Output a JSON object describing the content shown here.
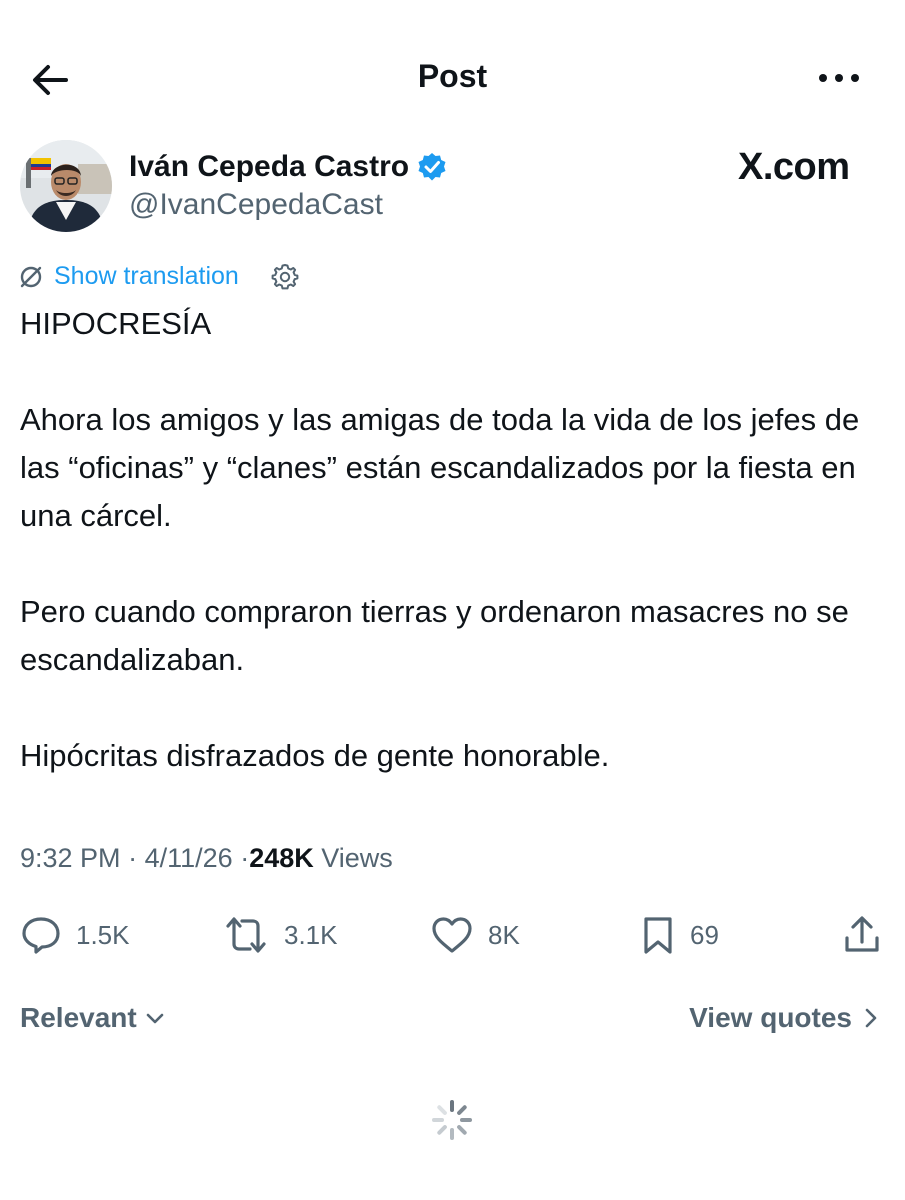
{
  "topbar": {
    "title": "Post"
  },
  "author": {
    "name": "Iván Cepeda Castro",
    "handle": "@IvanCepedaCast",
    "verified": true
  },
  "brand": {
    "label": "X.com"
  },
  "translation": {
    "label": "Show translation"
  },
  "tweet": {
    "paragraphs": [
      "HIPOCRESÍA",
      "Ahora los amigos y las amigas de toda la vida de los jefes de las “oficinas” y “clanes” están escandalizados por la fiesta en una cárcel.",
      "Pero cuando compraron tierras y ordenaron masacres no se escandalizaban.",
      "Hipócritas disfrazados de gente honorable."
    ]
  },
  "meta": {
    "time": "9:32 PM",
    "date": "4/11/26",
    "views_count": "248K",
    "views_label": "Views",
    "separator": "·"
  },
  "actions": {
    "replies": "1.5K",
    "reposts": "3.1K",
    "likes": "8K",
    "bookmarks": "69"
  },
  "replies_section": {
    "sort_label": "Relevant",
    "view_quotes_label": "View quotes"
  },
  "colors": {
    "accent": "#1d9bf0",
    "text": "#0f1419",
    "muted": "#536471"
  },
  "icons": [
    "back-arrow-icon",
    "more-icon",
    "verified-badge-icon",
    "translate-icon",
    "gear-icon",
    "reply-icon",
    "repost-icon",
    "like-icon",
    "bookmark-icon",
    "share-icon",
    "chevron-down-icon",
    "chevron-right-icon",
    "spinner-icon"
  ]
}
